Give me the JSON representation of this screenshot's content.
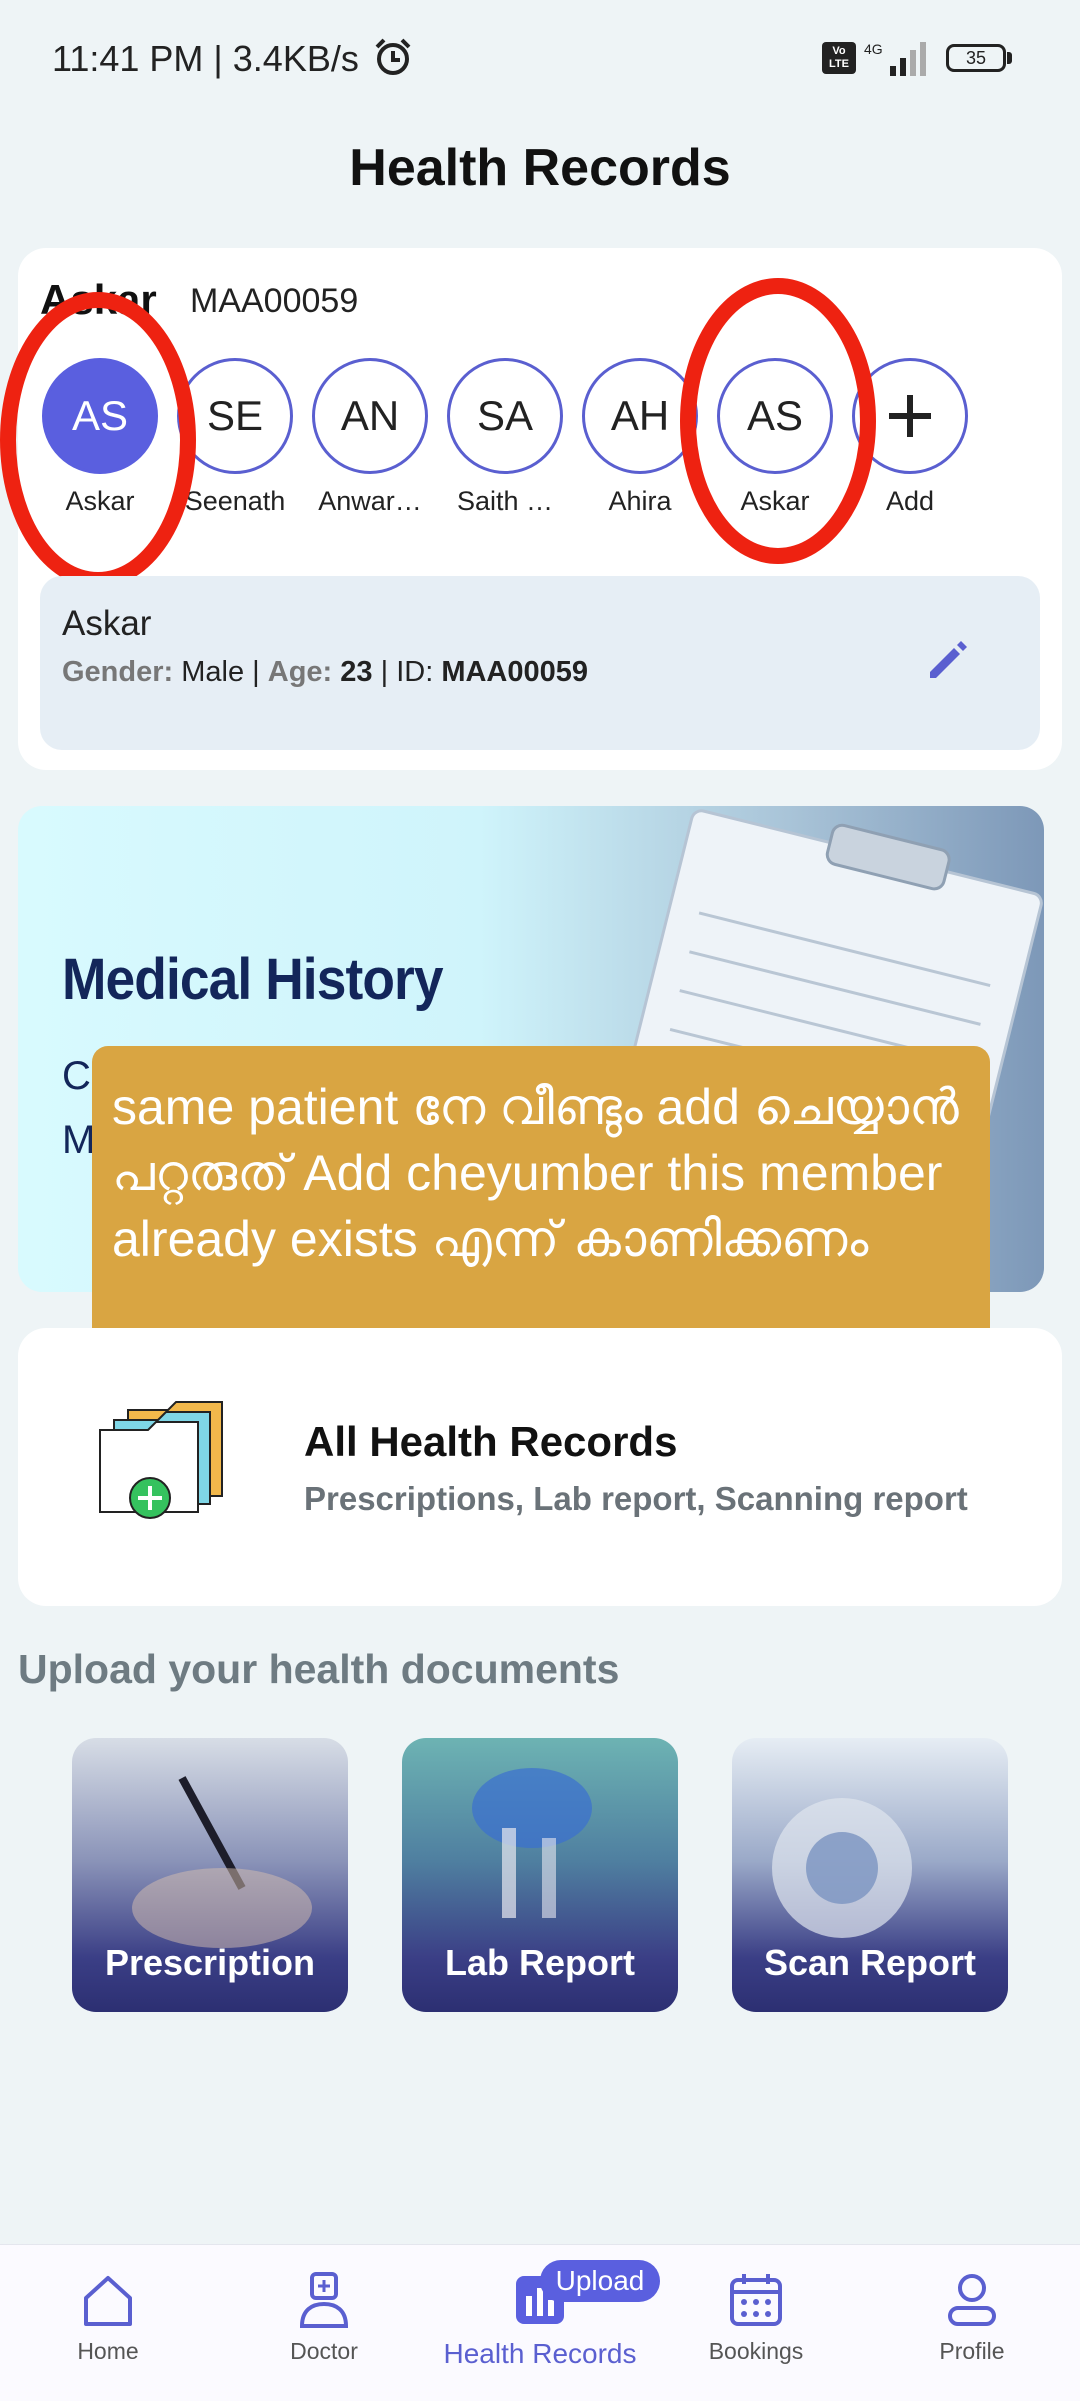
{
  "status_bar": {
    "time_speed": "11:41 PM | 3.4KB/s",
    "network": "4G",
    "volte": "Vo LTE",
    "battery": "35"
  },
  "page_title": "Health Records",
  "patient": {
    "name": "Askar",
    "id": "MAA00059"
  },
  "members": [
    {
      "initials": "AS",
      "label": "Askar",
      "selected": true
    },
    {
      "initials": "SE",
      "label": "Seenath",
      "selected": false
    },
    {
      "initials": "AN",
      "label": "Anwar…",
      "selected": false
    },
    {
      "initials": "SA",
      "label": "Saith …",
      "selected": false
    },
    {
      "initials": "AH",
      "label": "Ahira",
      "selected": false
    },
    {
      "initials": "AS",
      "label": "Askar",
      "selected": false
    },
    {
      "initials": "+",
      "label": "Add",
      "selected": false
    }
  ],
  "info": {
    "name": "Askar",
    "gender_key": "Gender:",
    "gender_val": "Male",
    "age_key": "Age:",
    "age_val": "23",
    "id_key": "ID:",
    "id_val": "MAA00059",
    "sep": " | "
  },
  "banner": {
    "title": "Medical History",
    "sub1": "Cr",
    "sub2": "M"
  },
  "annotation_note": "same patient നേ വീണ്ടും add ചെയ്യാൻ പറ്റരുത് Add cheyumber  this member already exists എന്ന് കാണിക്കണം",
  "records": {
    "title": "All Health Records",
    "subtitle": "Prescriptions, Lab report, Scanning report"
  },
  "upload_heading": "Upload your health documents",
  "documents": [
    {
      "label": "Prescription"
    },
    {
      "label": "Lab Report"
    },
    {
      "label": "Scan Report"
    }
  ],
  "nav": {
    "home": "Home",
    "doctor": "Doctor",
    "health_records": "Health Records",
    "upload_badge": "Upload",
    "bookings": "Bookings",
    "profile": "Profile"
  },
  "colors": {
    "accent": "#5a5fdf",
    "annotation_red": "#ee2211",
    "note_bg": "#d9a542",
    "banner_title": "#13265a"
  }
}
